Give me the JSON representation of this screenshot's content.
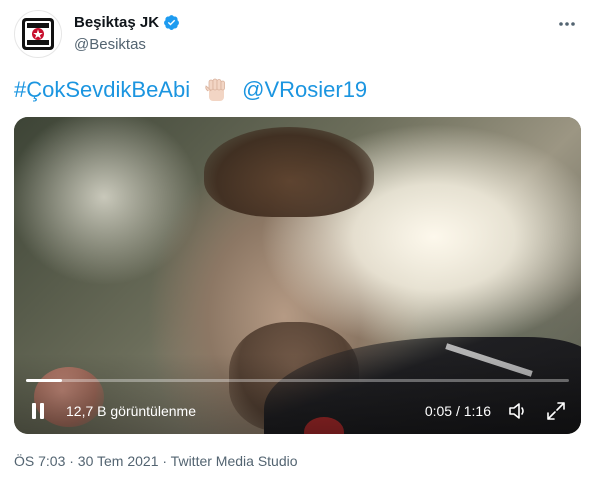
{
  "author": {
    "display_name": "Beşiktaş JK",
    "handle": "@Besiktas",
    "verified": true,
    "avatar_icon": "besiktas-crest-icon"
  },
  "tweet": {
    "hashtag": "#ÇokSevdikBeAbi",
    "emoji": "raised-fist-emoji",
    "mention": "@VRosier19"
  },
  "video": {
    "views_label": "12,7 B görüntülenme",
    "time_label": "0:05 / 1:16",
    "progress": 0.066
  },
  "meta": {
    "timestamp": "ÖS 7:03 · 30 Tem 2021 · Twitter Media Studio"
  },
  "colors": {
    "link": "#1d9bf0",
    "verified": "#1d9bf0",
    "secondary_text": "#536471"
  }
}
